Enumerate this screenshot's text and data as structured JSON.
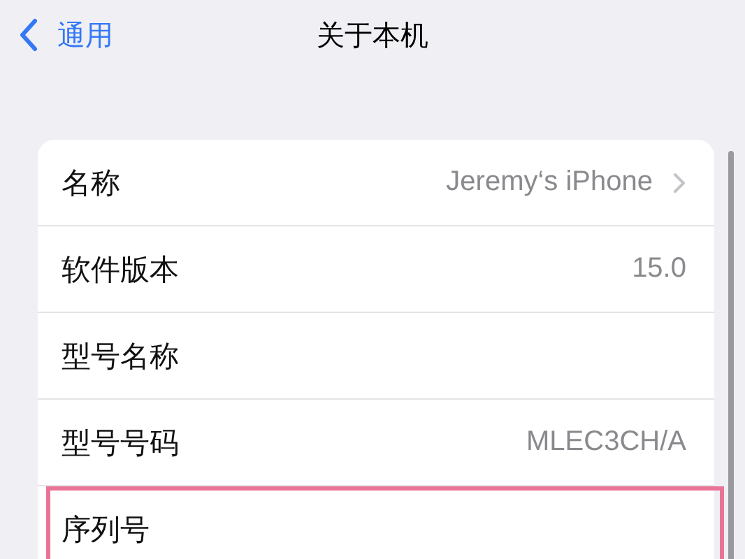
{
  "nav": {
    "back_label": "通用",
    "title": "关于本机"
  },
  "rows": [
    {
      "label": "名称",
      "value": "Jeremy‘s iPhone",
      "chevron": true,
      "highlighted": false
    },
    {
      "label": "软件版本",
      "value": "15.0",
      "chevron": false,
      "highlighted": false
    },
    {
      "label": "型号名称",
      "chevron": false,
      "highlighted": false
    },
    {
      "label": "型号号码",
      "value": "MLEC3CH/A",
      "chevron": false,
      "highlighted": false
    },
    {
      "label": "序列号",
      "chevron": false,
      "highlighted": true
    }
  ]
}
